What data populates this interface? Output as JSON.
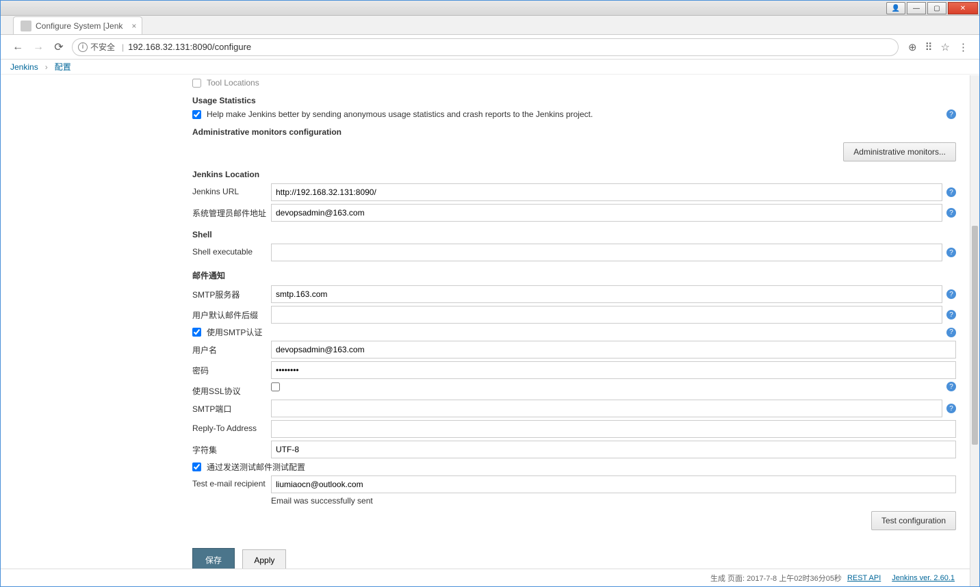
{
  "window": {
    "tab_title": "Configure System [Jenk"
  },
  "address": {
    "insecure_label": "不安全",
    "url": "192.168.32.131:8090/configure"
  },
  "breadcrumb": {
    "root": "Jenkins",
    "current": "配置"
  },
  "sections": {
    "tool_locations": "Tool Locations",
    "usage_stats_title": "Usage Statistics",
    "usage_stats_label": "Help make Jenkins better by sending anonymous usage statistics and crash reports to the Jenkins project.",
    "admin_monitors_title": "Administrative monitors configuration",
    "admin_monitors_btn": "Administrative monitors...",
    "jenkins_location_title": "Jenkins Location",
    "jenkins_url_label": "Jenkins URL",
    "jenkins_url_value": "http://192.168.32.131:8090/",
    "admin_email_label": "系统管理员邮件地址",
    "admin_email_value": "devopsadmin@163.com",
    "shell_title": "Shell",
    "shell_exec_label": "Shell executable",
    "shell_exec_value": "",
    "mail_title": "邮件通知",
    "smtp_server_label": "SMTP服务器",
    "smtp_server_value": "smtp.163.com",
    "default_suffix_label": "用户默认邮件后缀",
    "default_suffix_value": "",
    "use_smtp_auth_label": "使用SMTP认证",
    "username_label": "用户名",
    "username_value": "devopsadmin@163.com",
    "password_label": "密码",
    "password_value": "••••••••",
    "use_ssl_label": "使用SSL协议",
    "smtp_port_label": "SMTP端口",
    "smtp_port_value": "",
    "reply_to_label": "Reply-To Address",
    "reply_to_value": "",
    "charset_label": "字符集",
    "charset_value": "UTF-8",
    "test_send_label": "通过发送测试邮件测试配置",
    "test_recipient_label": "Test e-mail recipient",
    "test_recipient_value": "liumiaocn@outlook.com",
    "sent_ok_msg": "Email was successfully sent",
    "test_config_btn": "Test configuration",
    "save_btn": "保存",
    "apply_btn": "Apply"
  },
  "footer": {
    "gen_time": "生成 页面: 2017-7-8 上午02时36分05秒",
    "rest_api": "REST API",
    "version": "Jenkins ver. 2.60.1"
  }
}
